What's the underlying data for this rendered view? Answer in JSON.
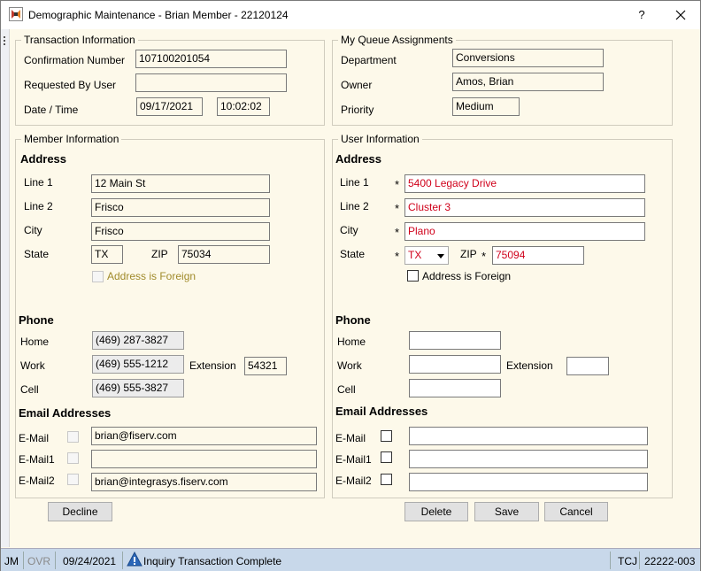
{
  "window": {
    "title": "Demographic Maintenance - Brian Member - 22120124",
    "help": "?",
    "close_glyph": "✕"
  },
  "transaction": {
    "title": "Transaction Information",
    "confirmation_label": "Confirmation Number",
    "confirmation_value": "107100201054",
    "requested_label": "Requested By User",
    "requested_value": "",
    "datetime_label": "Date / Time",
    "date_value": "09/17/2021",
    "time_value": "10:02:02"
  },
  "queue": {
    "title": "My Queue Assignments",
    "department_label": "Department",
    "department_value": "Conversions",
    "owner_label": "Owner",
    "owner_value": "Amos, Brian",
    "priority_label": "Priority",
    "priority_value": "Medium"
  },
  "member": {
    "title": "Member Information",
    "address_heading": "Address",
    "line1_label": "Line 1",
    "line1_value": "12 Main St",
    "line2_label": "Line 2",
    "line2_value": "Frisco",
    "city_label": "City",
    "city_value": "Frisco",
    "state_label": "State",
    "state_value": "TX",
    "zip_label": "ZIP",
    "zip_value": "75034",
    "foreign_label": "Address is Foreign",
    "phone_heading": "Phone",
    "home_label": "Home",
    "home_value": "(469) 287-3827",
    "work_label": "Work",
    "work_value": "(469) 555-1212",
    "extension_label": "Extension",
    "extension_value": "54321",
    "cell_label": "Cell",
    "cell_value": "(469) 555-3827",
    "email_heading": "Email Addresses",
    "email_label": "E-Mail",
    "email_value": "brian@fiserv.com",
    "email1_label": "E-Mail1",
    "email1_value": "",
    "email2_label": "E-Mail2",
    "email2_value": "brian@integrasys.fiserv.com"
  },
  "user": {
    "title": "User Information",
    "address_heading": "Address",
    "required_mark": "*",
    "line1_label": "Line 1",
    "line1_value": "5400 Legacy Drive",
    "line2_label": "Line 2",
    "line2_value": "Cluster 3",
    "city_label": "City",
    "city_value": "Plano",
    "state_label": "State",
    "state_value": "TX",
    "zip_label": "ZIP",
    "zip_value": "75094",
    "foreign_label": "Address is Foreign",
    "phone_heading": "Phone",
    "home_label": "Home",
    "home_value": "",
    "work_label": "Work",
    "work_value": "",
    "extension_label": "Extension",
    "extension_value": "",
    "cell_label": "Cell",
    "cell_value": "",
    "email_heading": "Email Addresses",
    "email_label": "E-Mail",
    "email_value": "",
    "email1_label": "E-Mail1",
    "email1_value": "",
    "email2_label": "E-Mail2",
    "email2_value": ""
  },
  "buttons": {
    "decline": "Decline",
    "delete": "Delete",
    "save": "Save",
    "cancel": "Cancel"
  },
  "status": {
    "user": "JM",
    "ovr": "OVR",
    "date": "09/24/2021",
    "message": "Inquiry Transaction Complete",
    "code": "TCJ",
    "number": "22222-003"
  },
  "colors": {
    "required": "#d0021b",
    "status_bar": "#c8d8ea",
    "panel": "#fdf9ea",
    "foreign_label": "#a08a2a"
  }
}
